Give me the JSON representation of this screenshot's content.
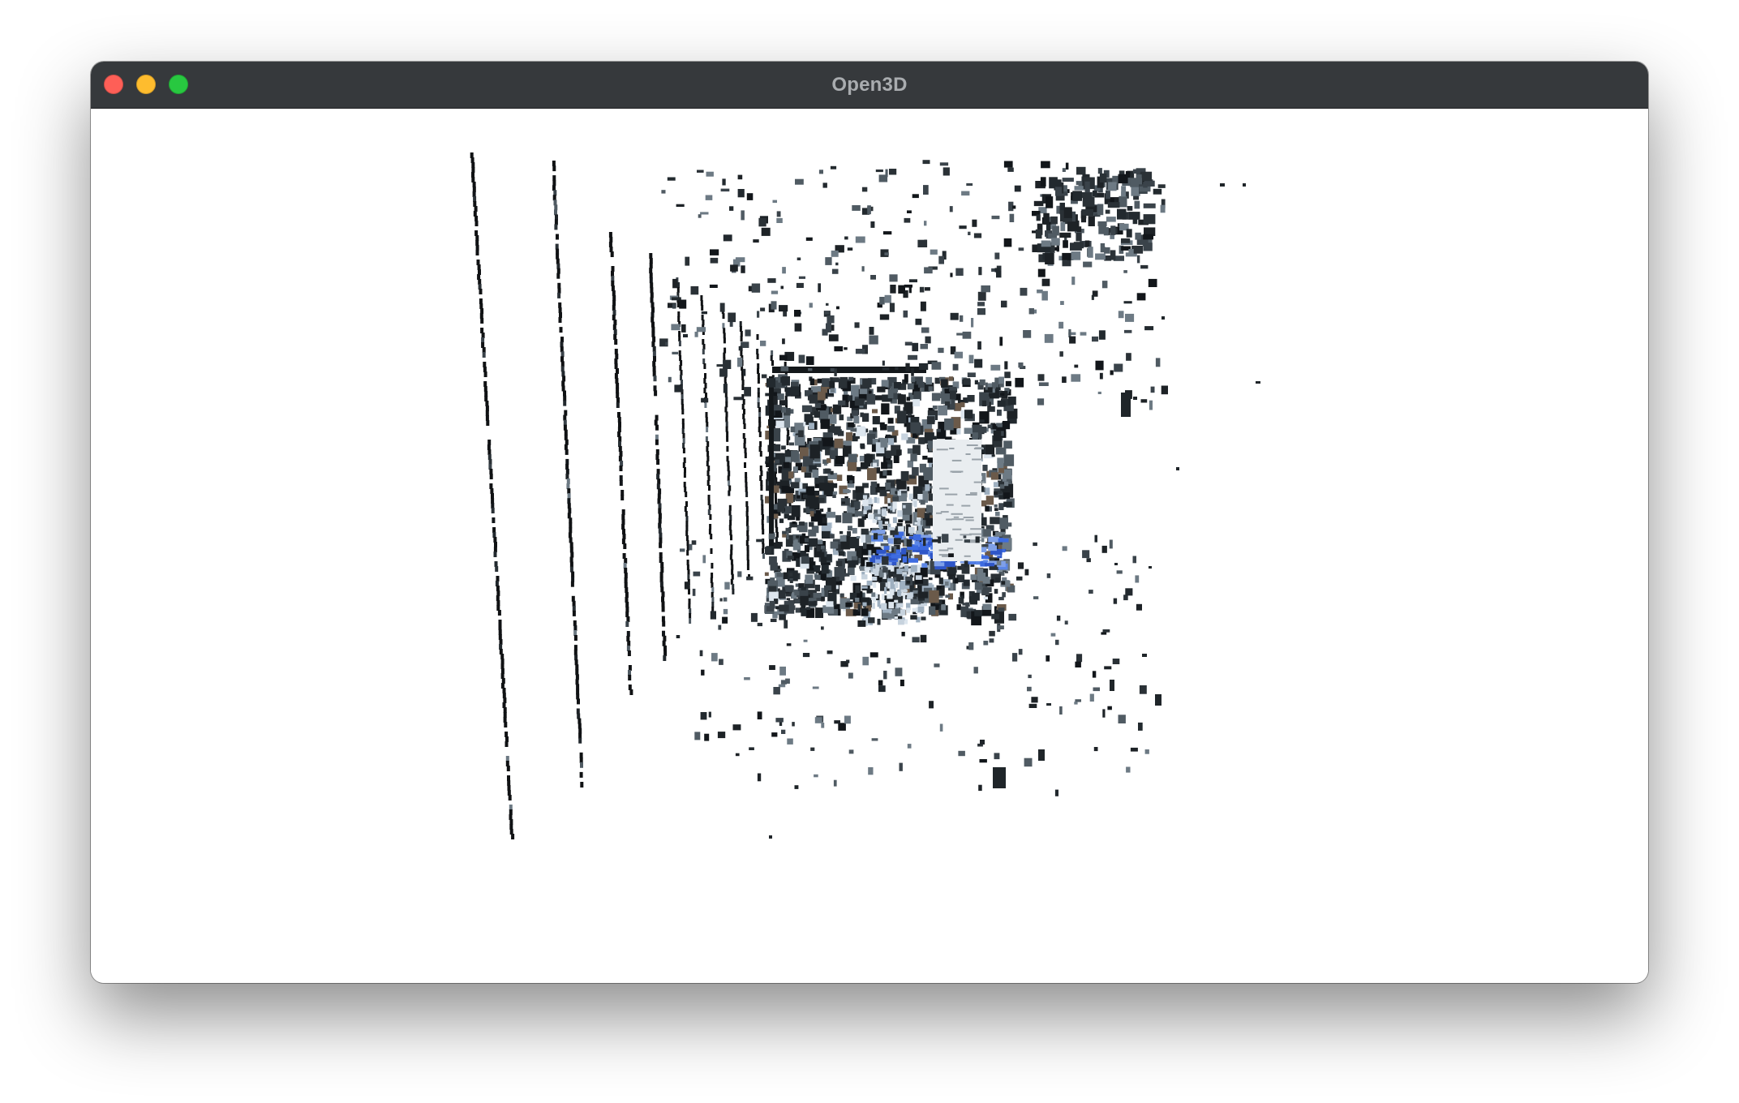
{
  "window": {
    "title": "Open3D"
  },
  "viewport": {
    "background": "#ffffff",
    "content": "point-cloud"
  },
  "colors": {
    "titlebar": "#36393c",
    "close": "#fe5f57",
    "minimize": "#febc2e",
    "maximize": "#28c840"
  }
}
